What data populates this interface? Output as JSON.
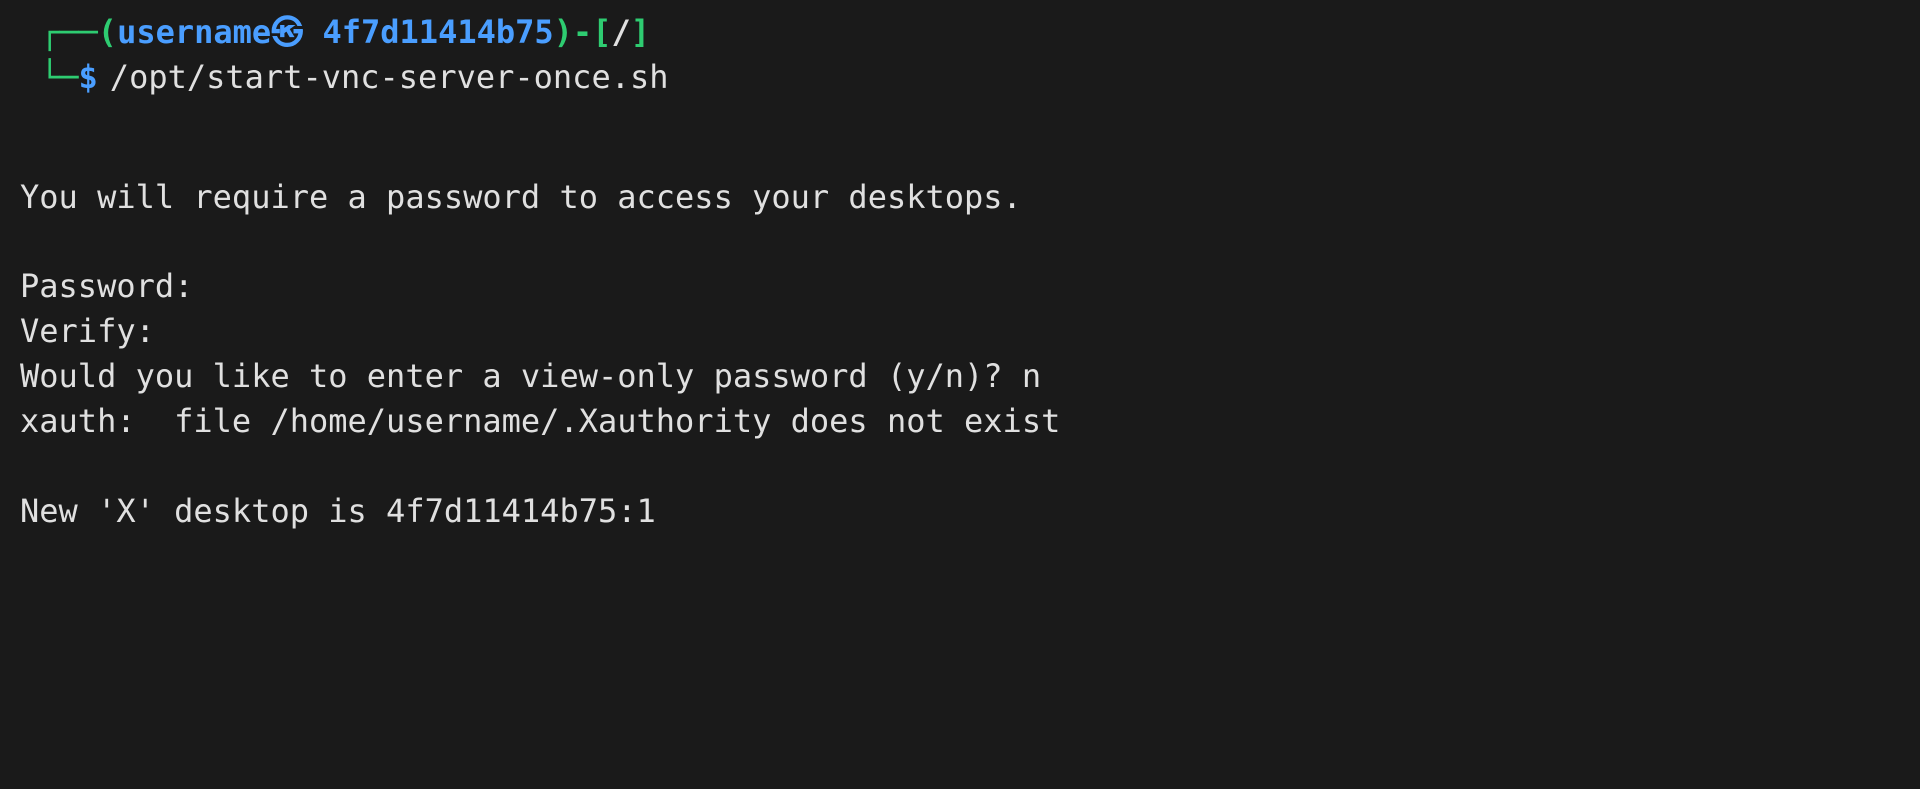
{
  "prompt": {
    "box_top": "┌──",
    "box_bottom": "└─",
    "paren_open": "(",
    "paren_close": ")",
    "username": "username",
    "circle_k": "㉿",
    "hostname": "4f7d11414b75",
    "dash": "-",
    "bracket_open": "[",
    "bracket_close": "]",
    "path": "/",
    "dollar": "$",
    "command": "/opt/start-vnc-server-once.sh"
  },
  "output": {
    "line1": "You will require a password to access your desktops.",
    "line2": "Password:",
    "line3": "Verify:",
    "line4": "Would you like to enter a view-only password (y/n)? n",
    "line5": "xauth:  file /home/username/.Xauthority does not exist",
    "line6": "New 'X' desktop is 4f7d11414b75:1"
  }
}
